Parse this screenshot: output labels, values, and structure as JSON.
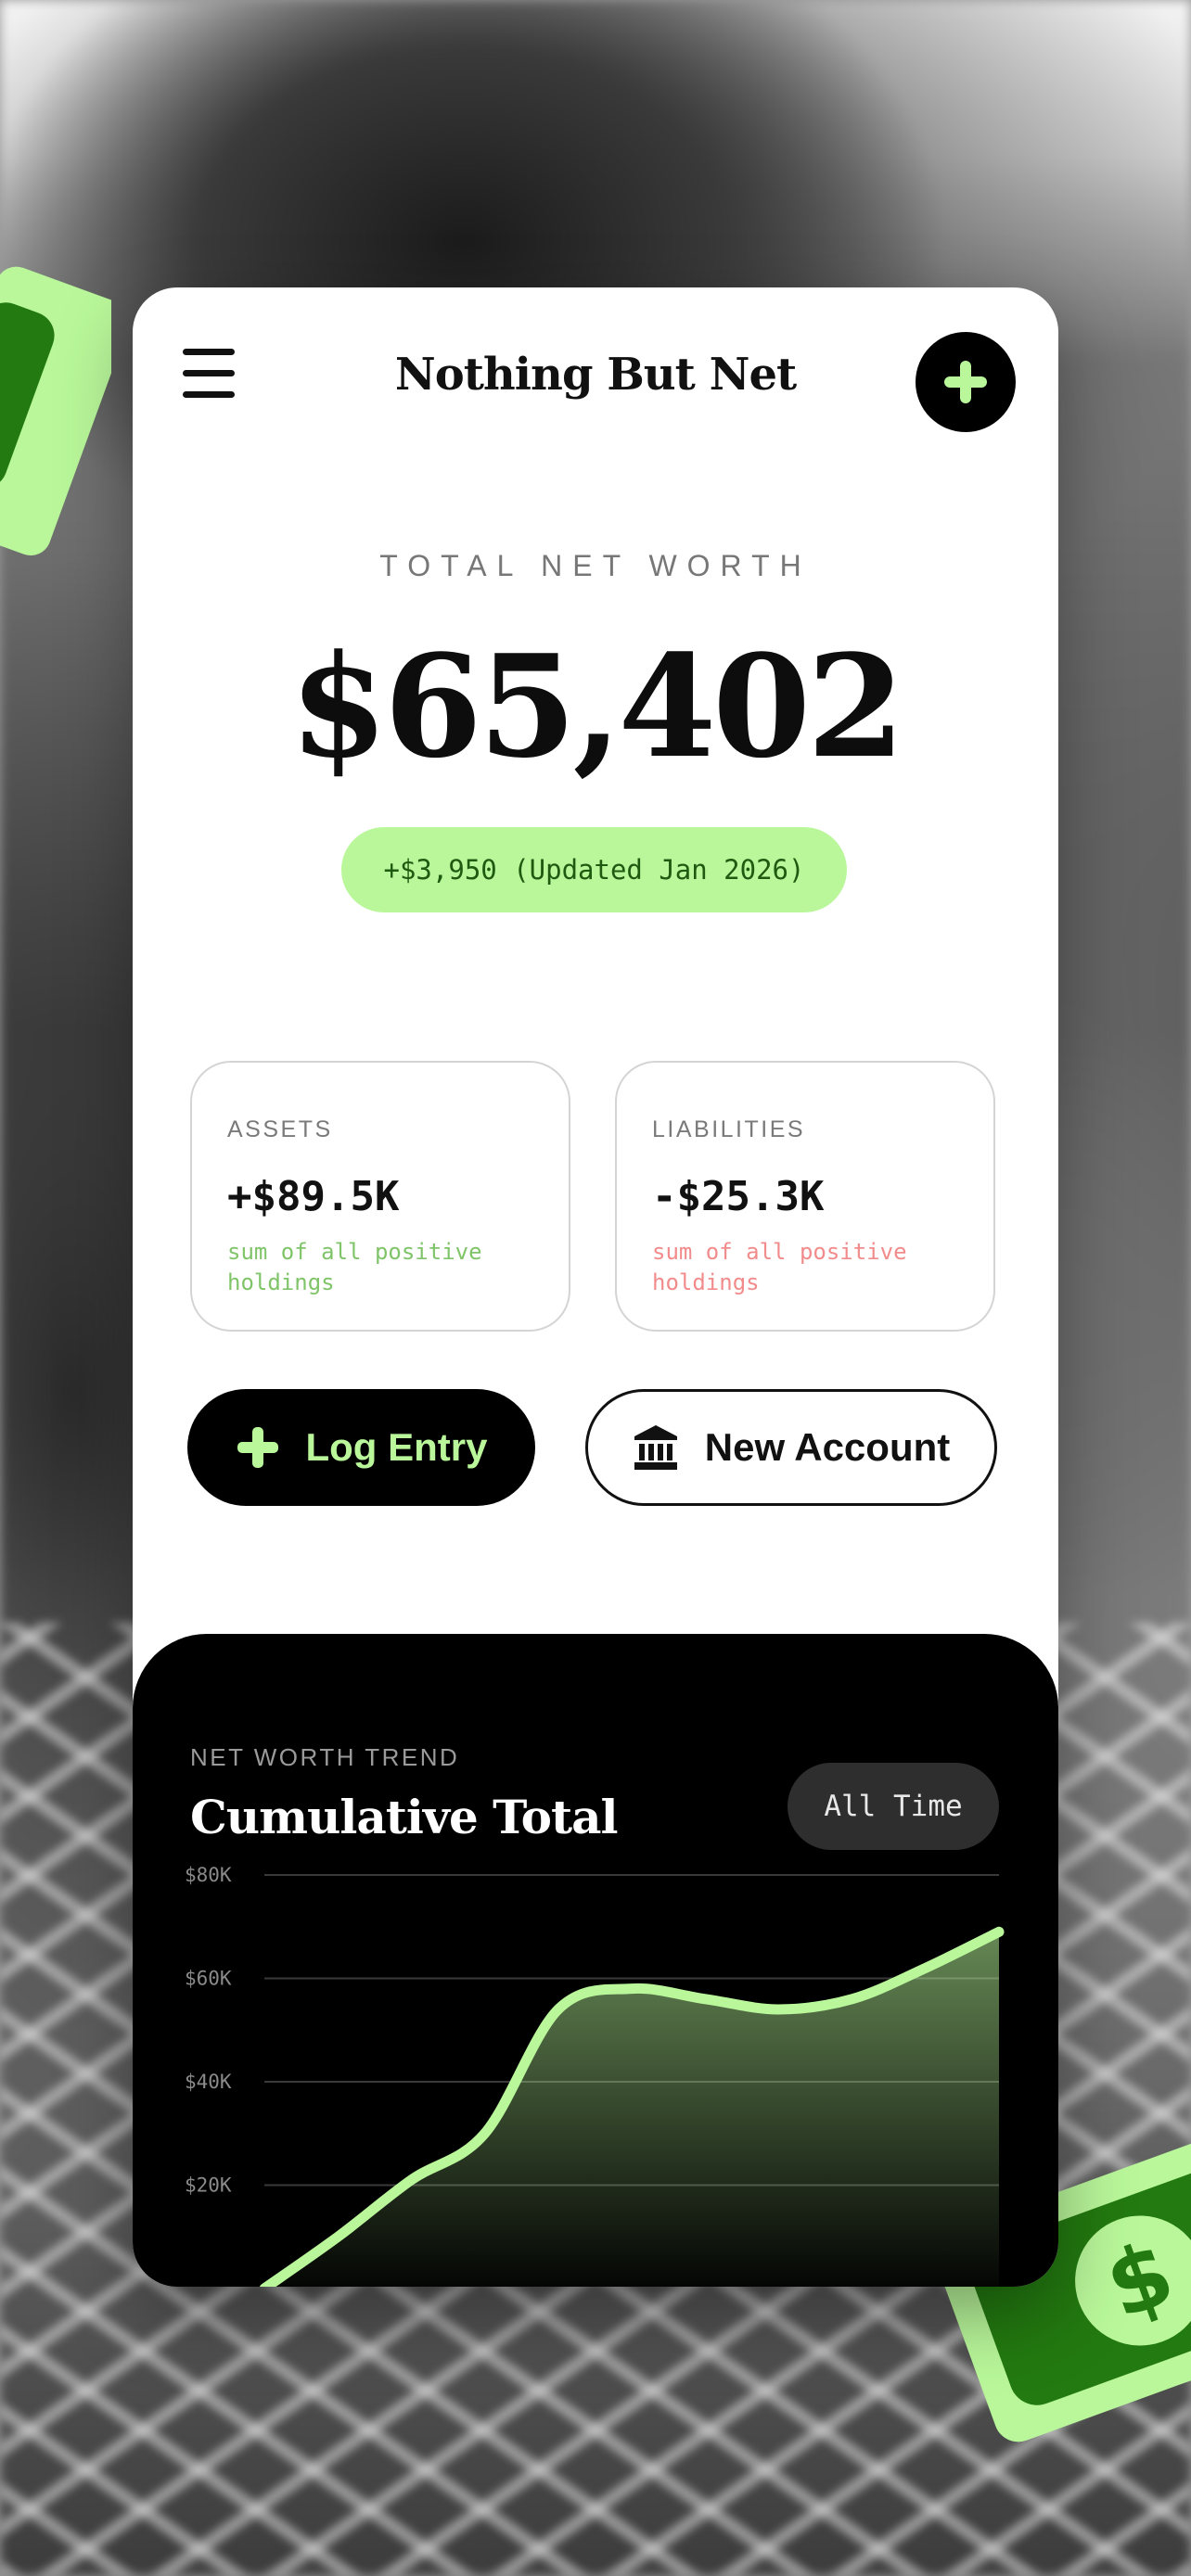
{
  "app": {
    "title": "Nothing But Net"
  },
  "summary": {
    "label": "TOTAL NET WORTH",
    "value": "$65,402",
    "change": "+$3,950 (Updated Jan 2026)"
  },
  "stats": {
    "assets": {
      "label": "ASSETS",
      "value": "+$89.5K",
      "note": "sum of all positive holdings",
      "color": "#7fc468"
    },
    "liabilities": {
      "label": "LIABILITIES",
      "value": "-$25.3K",
      "note": "sum of all positive holdings",
      "color": "#f28b8b"
    }
  },
  "actions": {
    "log_entry": "Log Entry",
    "new_account": "New Account"
  },
  "trend": {
    "kicker": "NET WORTH TREND",
    "title": "Cumulative Total",
    "range": "All Time"
  },
  "colors": {
    "accent": "#b9f79a",
    "bill_dark": "#237a10"
  },
  "chart_data": {
    "type": "area",
    "title": "Cumulative Total",
    "x": [
      0,
      1,
      2,
      3,
      4,
      5,
      6,
      7,
      8,
      9,
      10
    ],
    "y": [
      0,
      10000,
      21000,
      30000,
      54000,
      58000,
      56000,
      54000,
      56000,
      62000,
      69000
    ],
    "ylim": [
      0,
      80000
    ],
    "yticks": [
      20000,
      40000,
      60000,
      80000
    ],
    "ytick_labels": [
      "$20K",
      "$40K",
      "$60K",
      "$80K"
    ],
    "grid": true,
    "line_color": "#b9f79a"
  }
}
